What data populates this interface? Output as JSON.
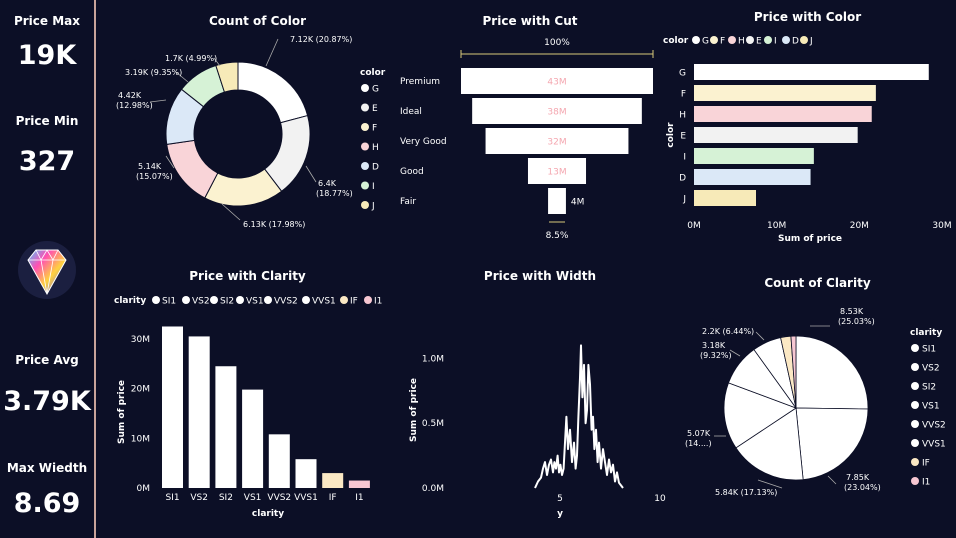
{
  "kpis": [
    {
      "label": "Price Max",
      "value": "19K"
    },
    {
      "label": "Price Min",
      "value": "327"
    },
    {
      "label": "Price Avg",
      "value": "3.79K"
    },
    {
      "label": "Max Wiedth",
      "value": "8.69"
    }
  ],
  "colors": {
    "G": "#ffffff",
    "E": "#f2f2f2",
    "F": "#fbf2d0",
    "H": "#f9d4d8",
    "D": "#dbe8f7",
    "I": "#d6f2d6",
    "J": "#f7eab8",
    "IF": "#fbe8c4",
    "I1": "#f7c7d2"
  },
  "charts": {
    "count_color": {
      "title": "Count of Color",
      "legend_title": "color",
      "legend": [
        "G",
        "E",
        "F",
        "H",
        "D",
        "I",
        "J"
      ],
      "chart_data": {
        "type": "pie",
        "variant": "donut",
        "categories": [
          "G",
          "E",
          "F",
          "H",
          "D",
          "I",
          "J"
        ],
        "values": [
          7120,
          6400,
          6130,
          5140,
          4420,
          3190,
          1700
        ],
        "labels": [
          "7.12K (20.87%)",
          "6.4K (18.77%)",
          "6.13K (17.98%)",
          "5.14K (15.07%)",
          "4.42K (12.98%)",
          "3.19K (9.35%)",
          "1.7K (4.99%)"
        ]
      }
    },
    "price_cut": {
      "title": "Price with Cut",
      "top_label": "100%",
      "bottom_label": "8.5%",
      "chart_data": {
        "type": "bar",
        "variant": "funnel",
        "categories": [
          "Premium",
          "Ideal",
          "Very Good",
          "Good",
          "Fair"
        ],
        "values": [
          43,
          38,
          32,
          13,
          4
        ],
        "labels": [
          "43M",
          "38M",
          "32M",
          "13M",
          "4M"
        ]
      }
    },
    "price_color": {
      "title": "Price with Color",
      "legend_title": "color",
      "legend": [
        "G",
        "F",
        "H",
        "E",
        "I",
        "D",
        "J"
      ],
      "xlabel": "Sum of price",
      "ylabel": "color",
      "ticks": [
        "0M",
        "10M",
        "20M",
        "30M"
      ],
      "chart_data": {
        "type": "bar",
        "orientation": "horizontal",
        "categories": [
          "G",
          "F",
          "H",
          "E",
          "I",
          "D",
          "J"
        ],
        "values": [
          28.4,
          22.0,
          21.5,
          19.8,
          14.5,
          14.1,
          7.5
        ],
        "xlim": [
          0,
          30
        ]
      }
    },
    "price_clarity": {
      "title": "Price with Clarity",
      "legend_title": "clarity",
      "legend": [
        "SI1",
        "VS2",
        "SI2",
        "VS1",
        "VVS2",
        "VVS1",
        "IF",
        "I1"
      ],
      "xlabel": "clarity",
      "ylabel": "Sum of price",
      "ticks": [
        "0M",
        "10M",
        "20M",
        "30M"
      ],
      "chart_data": {
        "type": "bar",
        "categories": [
          "SI1",
          "VS2",
          "SI2",
          "VS1",
          "VVS2",
          "VVS1",
          "IF",
          "I1"
        ],
        "values": [
          32.5,
          30.5,
          24.5,
          19.8,
          10.8,
          5.8,
          3.0,
          1.5
        ],
        "ylim": [
          0,
          33
        ]
      }
    },
    "price_width": {
      "title": "Price with Width",
      "xlabel": "y",
      "ylabel": "Sum of price",
      "yticks": [
        "0.0M",
        "0.5M",
        "1.0M"
      ],
      "xticks": [
        "5",
        "10"
      ],
      "chart_data": {
        "type": "line",
        "x": [
          3.75,
          3.9,
          4.05,
          4.15,
          4.25,
          4.35,
          4.45,
          4.55,
          4.65,
          4.72,
          4.8,
          4.88,
          4.95,
          5.02,
          5.1,
          5.18,
          5.25,
          5.32,
          5.4,
          5.5,
          5.6,
          5.7,
          5.78,
          5.85,
          5.92,
          6.0,
          6.05,
          6.12,
          6.2,
          6.28,
          6.35,
          6.42,
          6.5,
          6.58,
          6.65,
          6.72,
          6.8,
          6.88,
          6.95,
          7.05,
          7.15,
          7.25,
          7.35,
          7.45,
          7.55,
          7.65,
          7.75,
          7.85,
          7.95,
          8.05,
          8.15
        ],
        "y": [
          0.0,
          0.05,
          0.08,
          0.15,
          0.2,
          0.1,
          0.18,
          0.22,
          0.12,
          0.2,
          0.15,
          0.25,
          0.12,
          0.18,
          0.1,
          0.15,
          0.35,
          0.55,
          0.3,
          0.45,
          0.2,
          0.35,
          0.15,
          0.25,
          0.55,
          0.85,
          1.1,
          0.7,
          0.95,
          0.5,
          0.6,
          0.95,
          0.8,
          0.45,
          0.55,
          0.3,
          0.45,
          0.2,
          0.35,
          0.15,
          0.3,
          0.2,
          0.1,
          0.22,
          0.12,
          0.18,
          0.05,
          0.12,
          0.04,
          0.02,
          0.0
        ],
        "xlim": [
          0,
          10
        ],
        "ylim": [
          0,
          1.25
        ]
      }
    },
    "count_clarity": {
      "title": "Count of Clarity",
      "legend_title": "clarity",
      "legend": [
        "SI1",
        "VS2",
        "SI2",
        "VS1",
        "VVS2",
        "VVS1",
        "IF",
        "I1"
      ],
      "chart_data": {
        "type": "pie",
        "categories": [
          "SI1",
          "VS2",
          "SI2",
          "VS1",
          "VVS2",
          "VVS1",
          "IF",
          "I1"
        ],
        "values": [
          8530,
          7850,
          5840,
          5070,
          3180,
          2200,
          780,
          380
        ],
        "labels": [
          "8.53K (25.03%)",
          "7.85K (23.04%)",
          "5.84K (17.13%)",
          "5.07K (14....)",
          "3.18K (9.32%)",
          "2.2K (6.44%)",
          "",
          ""
        ]
      }
    }
  }
}
